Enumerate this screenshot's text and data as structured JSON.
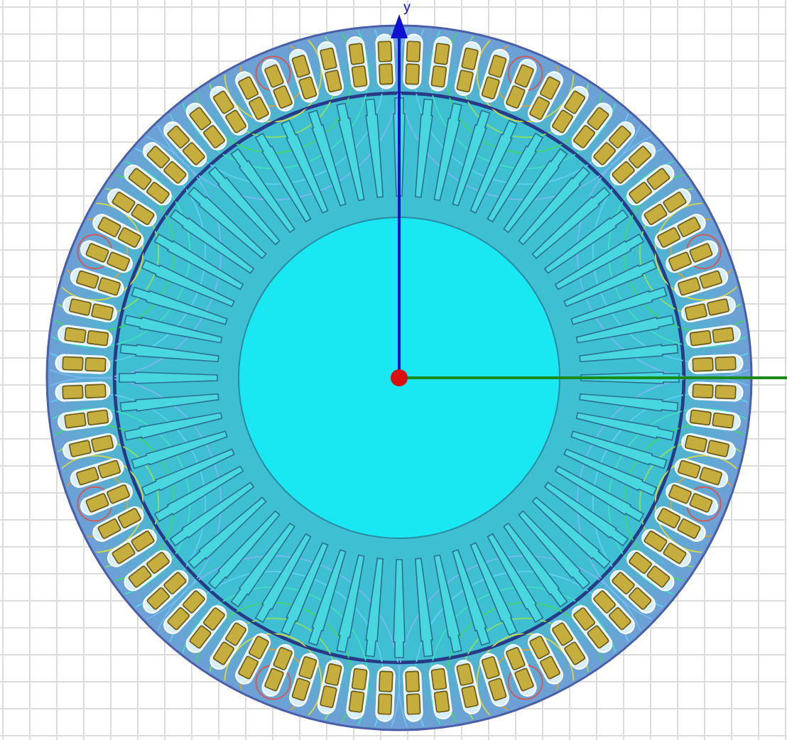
{
  "viewport": {
    "axis_label": "y"
  }
}
